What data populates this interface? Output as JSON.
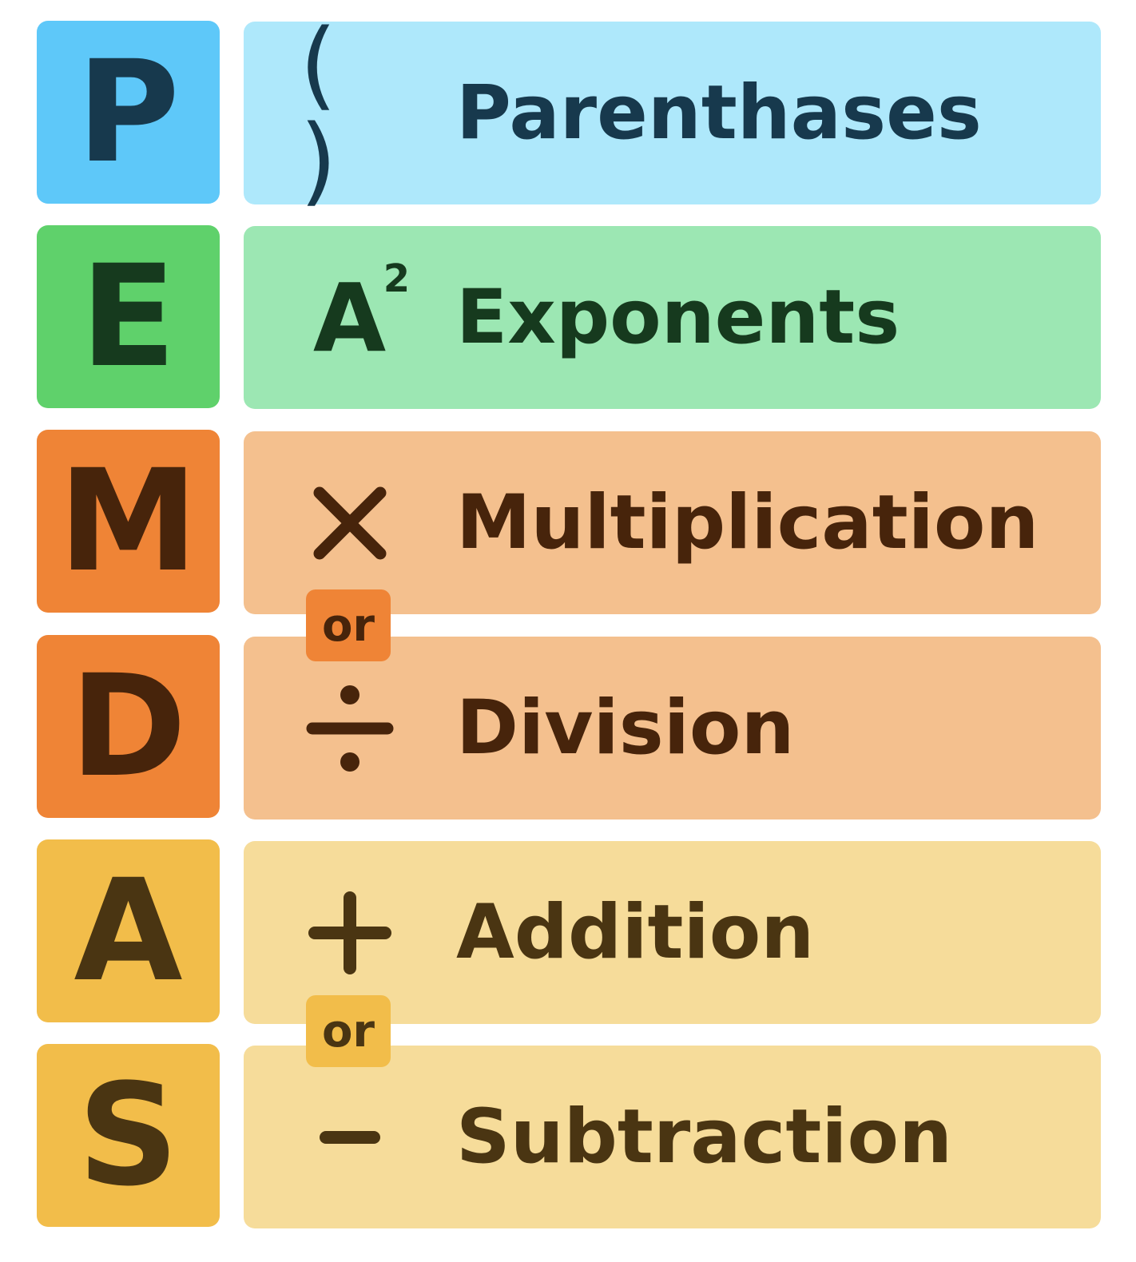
{
  "rows": [
    {
      "letter": "P",
      "symbol": "( )",
      "label": "Parenthases",
      "box_color": "#5ec8f9",
      "bar_color": "#aee8fb",
      "text_color": "#17394d"
    },
    {
      "letter": "E",
      "symbol_base": "A",
      "symbol_sup": "2",
      "label": "Exponents",
      "box_color": "#5fd16b",
      "bar_color": "#9ce7b3",
      "text_color": "#163a1e"
    },
    {
      "letter": "M",
      "symbol": "multiply-icon",
      "label": "Multiplication",
      "box_color": "#ef8436",
      "bar_color": "#f4c08e",
      "text_color": "#47240b"
    },
    {
      "letter": "D",
      "symbol": "divide-icon",
      "label": "Division",
      "box_color": "#ef8436",
      "bar_color": "#f4c08e",
      "text_color": "#47240b"
    },
    {
      "letter": "A",
      "symbol": "plus-icon",
      "label": "Addition",
      "box_color": "#f2bd4a",
      "bar_color": "#f6dc9a",
      "text_color": "#4a3512"
    },
    {
      "letter": "S",
      "symbol": "minus-icon",
      "label": "Subtraction",
      "box_color": "#f2bd4a",
      "bar_color": "#f6dc9a",
      "text_color": "#4a3512"
    }
  ],
  "connectors": [
    {
      "text": "or",
      "color": "#ef8436",
      "text_color": "#47240b"
    },
    {
      "text": "or",
      "color": "#f2bd4a",
      "text_color": "#4a3512"
    }
  ]
}
